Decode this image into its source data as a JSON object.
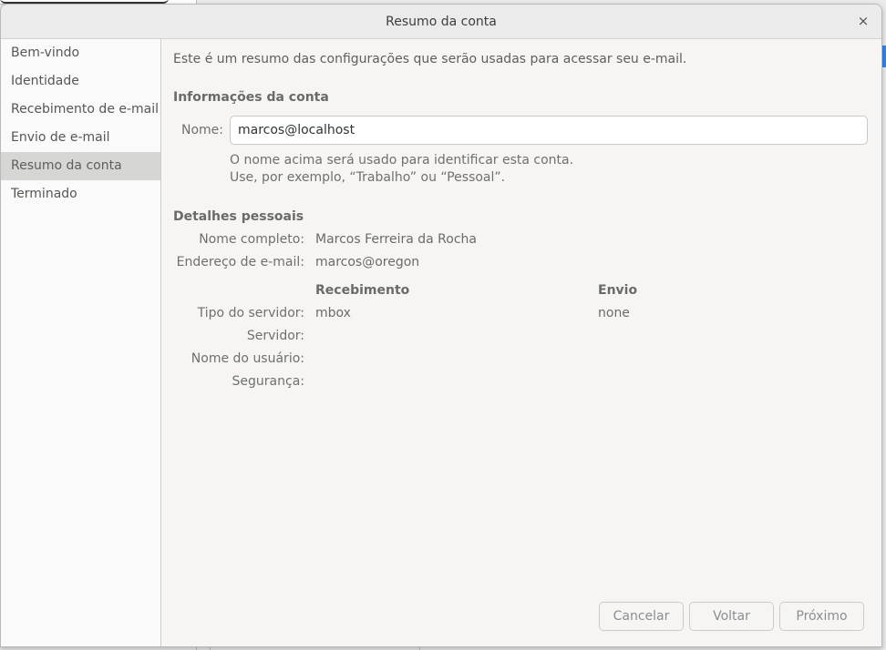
{
  "dialog": {
    "title": "Resumo da conta",
    "close_glyph": "×"
  },
  "sidebar": {
    "items": [
      {
        "label": "Bem-vindo"
      },
      {
        "label": "Identidade"
      },
      {
        "label": "Recebimento de e-mail"
      },
      {
        "label": "Envio de e-mail"
      },
      {
        "label": "Resumo da conta",
        "active": true
      },
      {
        "label": "Terminado"
      }
    ]
  },
  "main": {
    "intro": "Este é um resumo das configurações que serão usadas para acessar seu e-mail.",
    "account_info": {
      "title": "Informações da conta",
      "name_label": "Nome:",
      "name_value": "marcos@localhost",
      "hint_line1": "O nome acima será usado para identificar esta conta.",
      "hint_line2": "Use, por exemplo, “Trabalho” ou “Pessoal”."
    },
    "personal": {
      "title": "Detalhes pessoais",
      "fullname_label": "Nome completo:",
      "fullname_value": "Marcos Ferreira da Rocha",
      "email_label": "Endereço de e-mail:",
      "email_value": "marcos@oregon"
    },
    "servers": {
      "receiving_header": "Recebimento",
      "sending_header": "Envio",
      "type_label": "Tipo do servidor:",
      "type_receiving": "mbox",
      "type_sending": "none",
      "server_label": "Servidor:",
      "username_label": "Nome do usuário:",
      "security_label": "Segurança:"
    }
  },
  "buttons": {
    "cancel": "Cancelar",
    "back": "Voltar",
    "next": "Próximo"
  },
  "colors": {
    "accent": "#3584e4"
  }
}
